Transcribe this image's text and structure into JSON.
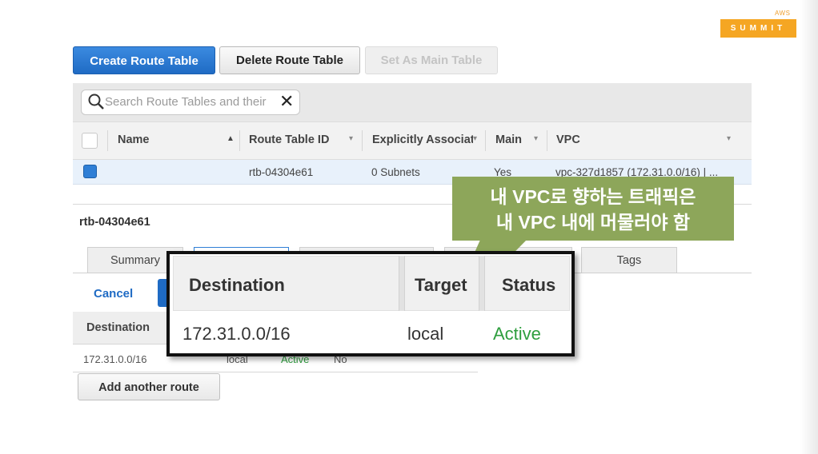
{
  "branding": {
    "aws": "AWS",
    "summit": "SUMMIT"
  },
  "toolbar": {
    "create_label": "Create Route Table",
    "delete_label": "Delete Route Table",
    "set_main_label": "Set As Main Table"
  },
  "search": {
    "placeholder": "Search Route Tables and their"
  },
  "table": {
    "columns": [
      "Name",
      "Route Table ID",
      "Explicitly Associat",
      "Main",
      "VPC"
    ],
    "row": {
      "name": "",
      "route_table_id": "rtb-04304e61",
      "explicit_association": "0 Subnets",
      "main": "Yes",
      "vpc": "vpc-327d1857 (172.31.0.0/16) | ..."
    }
  },
  "detail": {
    "title": "rtb-04304e61",
    "tabs": [
      "Summary",
      "Tags"
    ],
    "cancel_label": "Cancel",
    "routes_header": "Destination",
    "route": {
      "destination": "172.31.0.0/16",
      "target": "local",
      "status": "Active",
      "propagated": "No"
    },
    "add_route_label": "Add another route"
  },
  "zoom": {
    "headers": [
      "Destination",
      "Target",
      "Status"
    ],
    "row": {
      "destination": "172.31.0.0/16",
      "target": "local",
      "status": "Active"
    }
  },
  "annotation": {
    "line1": "내 VPC로 향하는 트래픽은",
    "line2": "내 VPC 내에 머물러야 함"
  },
  "colors": {
    "primary_button": "#1f6bc4",
    "annotation_bg": "#8da65a",
    "active_status": "#2e9e3e",
    "summit_orange": "#f5a623"
  }
}
